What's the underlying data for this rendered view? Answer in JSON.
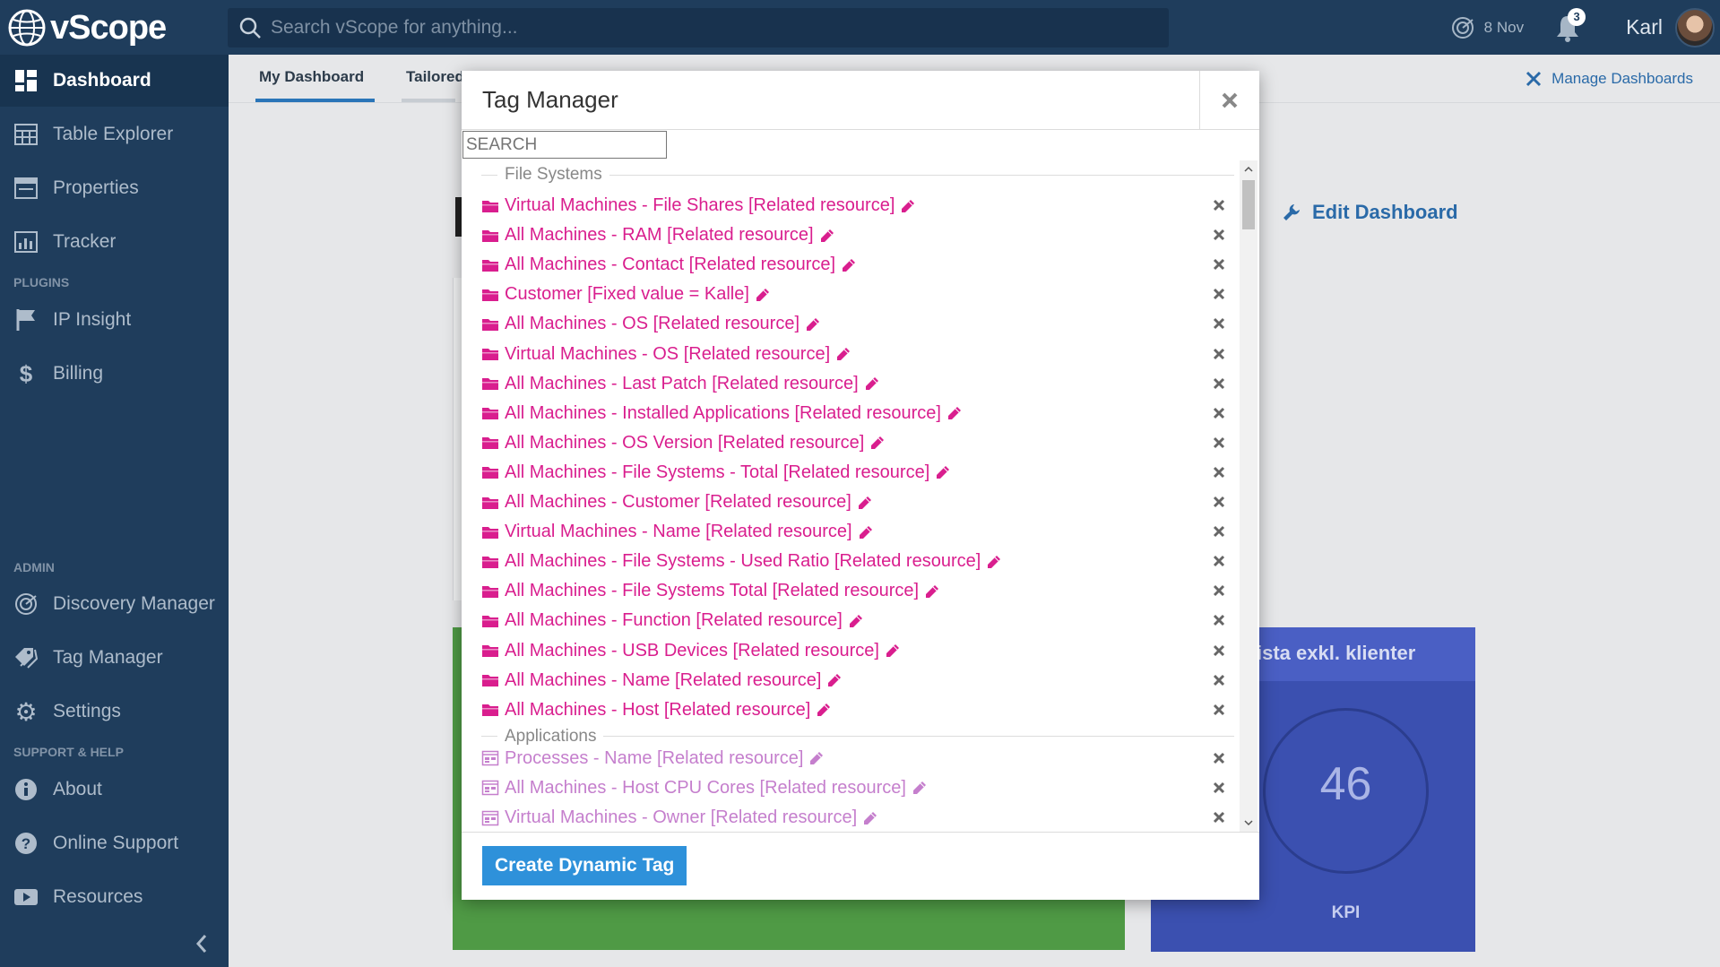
{
  "app": {
    "logo_text": "vScope"
  },
  "search": {
    "placeholder": "Search vScope for anything..."
  },
  "header": {
    "date": "8 Nov",
    "notifications_count": "3",
    "user_name": "Karl"
  },
  "sidebar": {
    "items": [
      {
        "label": "Dashboard",
        "icon": "dashboard-icon",
        "active": true
      },
      {
        "label": "Table Explorer",
        "icon": "table-icon"
      },
      {
        "label": "Properties",
        "icon": "properties-icon"
      },
      {
        "label": "Tracker",
        "icon": "tracker-icon"
      }
    ],
    "plugins_label": "PLUGINS",
    "plugins": [
      {
        "label": "IP Insight",
        "icon": "flag-icon"
      },
      {
        "label": "Billing",
        "icon": "dollar-icon"
      }
    ],
    "admin_label": "ADMIN",
    "admin": [
      {
        "label": "Discovery Manager",
        "icon": "radar-icon"
      },
      {
        "label": "Tag Manager",
        "icon": "tags-icon"
      },
      {
        "label": "Settings",
        "icon": "gear-icon"
      }
    ],
    "support_label": "SUPPORT & HELP",
    "support": [
      {
        "label": "About",
        "icon": "info-icon"
      },
      {
        "label": "Online Support",
        "icon": "question-icon"
      },
      {
        "label": "Resources",
        "icon": "video-icon"
      }
    ]
  },
  "tabs": [
    {
      "label": "My Dashboard"
    },
    {
      "label": "Tailored"
    }
  ],
  "manage_dashboards": "Manage Dashboards",
  "edit_dashboard": "Edit Dashboard",
  "kpi_card": {
    "title": "ista exkl. klienter",
    "value": "46",
    "label": "KPI"
  },
  "modal": {
    "title": "Tag Manager",
    "search_placeholder": "SEARCH",
    "create_button": "Create Dynamic Tag",
    "groups": [
      {
        "label": "File Systems",
        "items": [
          "Virtual Machines - File Shares [Related resource]",
          "All Machines - RAM [Related resource]",
          "All Machines - Contact [Related resource]",
          "Customer [Fixed value = Kalle]",
          "All Machines - OS [Related resource]",
          "Virtual Machines - OS [Related resource]",
          "All Machines - Last Patch [Related resource]",
          "All Machines - Installed Applications [Related resource]",
          "All Machines - OS Version [Related resource]",
          "All Machines - File Systems - Total [Related resource]",
          "All Machines - Customer [Related resource]",
          "Virtual Machines - Name [Related resource]",
          "All Machines - File Systems - Used Ratio [Related resource]",
          "All Machines - File Systems Total [Related resource]",
          "All Machines - Function [Related resource]",
          "All Machines - USB Devices [Related resource]",
          "All Machines - Name [Related resource]",
          "All Machines - Host [Related resource]"
        ]
      },
      {
        "label": "Applications",
        "items": [
          "Processes - Name [Related resource]",
          "All Machines - Host CPU Cores [Related resource]",
          "Virtual Machines - Owner [Related resource]"
        ]
      }
    ]
  },
  "colors": {
    "sidebar_bg": "#1f3d5c",
    "file_tag": "#d91e8e",
    "app_tag": "#c57fcd",
    "button": "#2e91da"
  }
}
